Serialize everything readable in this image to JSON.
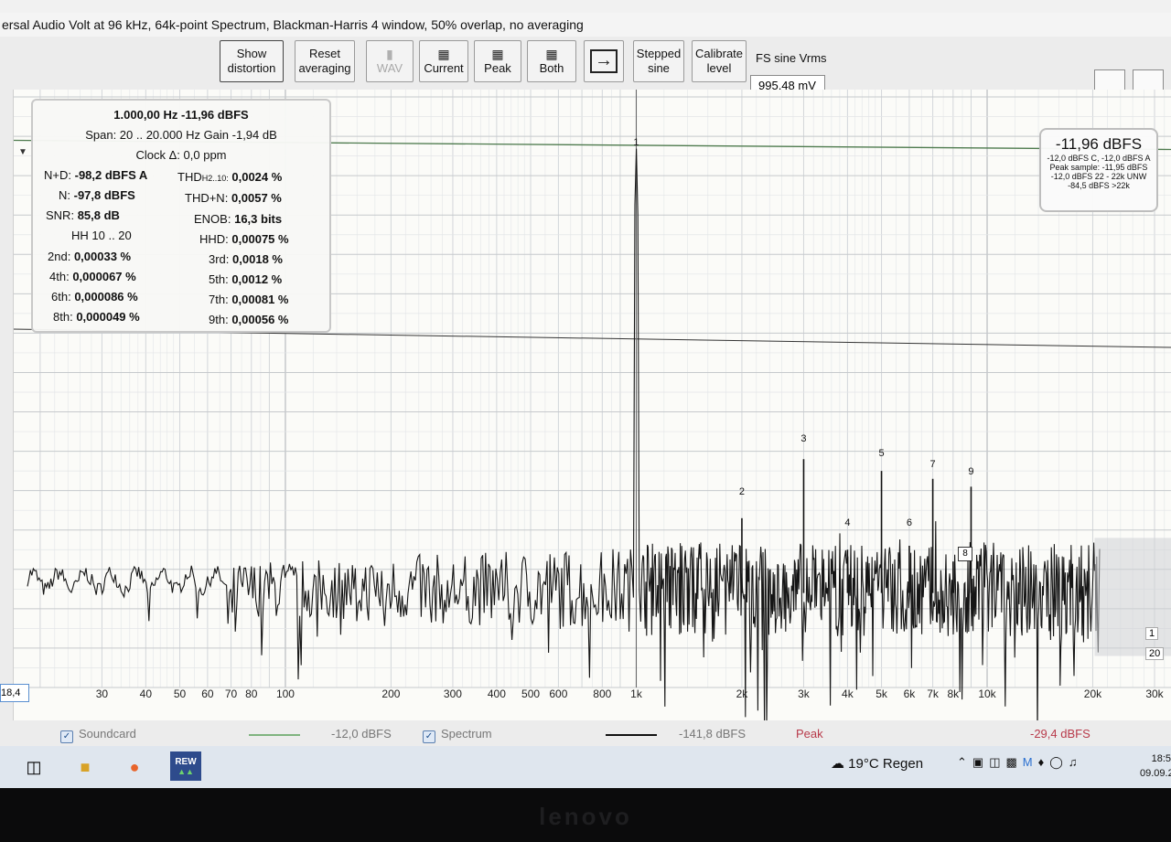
{
  "window": {
    "title": "ersal Audio Volt at 96 kHz, 64k-point Spectrum, Blackman-Harris 4 window, 50% overlap, no averaging"
  },
  "toolbar": {
    "buttons": [
      {
        "label": "Show\ndistortion",
        "icon": ""
      },
      {
        "label": "Reset\naveraging",
        "icon": ""
      },
      {
        "label": "WAV",
        "icon": "folder-icon"
      },
      {
        "label": "Current",
        "icon": "save-icon"
      },
      {
        "label": "Peak",
        "icon": "save-icon"
      },
      {
        "label": "Both",
        "icon": "save-icon"
      },
      {
        "label": "",
        "icon": "import-icon"
      },
      {
        "label": "Stepped\nsine",
        "icon": ""
      },
      {
        "label": "Calibrate\nlevel",
        "icon": ""
      }
    ],
    "fs_label": "FS sine Vrms",
    "fs_value": "995,48 mV"
  },
  "info": {
    "freq": "1.000,00 Hz  -11,96 dBFS",
    "span": "Span: 20 .. 20.000 Hz   Gain -1,94 dB",
    "clock": "Clock Δ: 0,0 ppm",
    "nd_label": "N+D:",
    "nd_value": "-98,2 dBFS A",
    "n_label": "N:",
    "n_value": "-97,8 dBFS",
    "snr_label": "SNR:",
    "snr_value": "85,8 dB",
    "hh": "HH 10 .. 20",
    "thd_label": "THD",
    "thd_sub": "H2..10:",
    "thd_value": "0,0024 %",
    "thdn_label": "THD+N:",
    "thdn_value": "0,0057 %",
    "enob_label": "ENOB:",
    "enob_value": "16,3 bits",
    "hhd_label": "HHD:",
    "hhd_value": "0,00075 %",
    "h2_label": "2nd:",
    "h2_value": "0,00033 %",
    "h3_label": "3rd:",
    "h3_value": "0,0018 %",
    "h4_label": "4th:",
    "h4_value": "0,000067 %",
    "h5_label": "5th:",
    "h5_value": "0,0012 %",
    "h6_label": "6th:",
    "h6_value": "0,000086 %",
    "h7_label": "7th:",
    "h7_value": "0,00081 %",
    "h8_label": "8th:",
    "h8_value": "0,000049 %",
    "h9_label": "9th:",
    "h9_value": "0,00056 %"
  },
  "readout": {
    "main": "-11,96 dBFS",
    "l1": "-12,0 dBFS C, -12,0 dBFS A",
    "l2": "Peak sample: -11,95 dBFS",
    "l3": "-12,0 dBFS 22 - 22k UNW",
    "l4": "-84,5 dBFS >22k"
  },
  "chart_data": {
    "type": "line",
    "x_scale": "log",
    "xlim": [
      18.4,
      30000
    ],
    "x_ticks": [
      "18,4",
      "30",
      "40",
      "50",
      "60",
      "70",
      "80",
      "100",
      "200",
      "300",
      "400",
      "500",
      "600",
      "800",
      "1k",
      "2k",
      "3k",
      "4k",
      "5k",
      "6k",
      "7k",
      "8k",
      "10k",
      "20k",
      "30k"
    ],
    "grid": true,
    "harmonic_labels": [
      "1",
      "2",
      "3",
      "4",
      "5",
      "6",
      "7",
      "8",
      "9"
    ],
    "right_axis_labels": [
      "1",
      "20"
    ],
    "series": [
      {
        "name": "Soundcard",
        "value": "-12,0 dBFS",
        "color": "#7fb37f"
      },
      {
        "name": "Spectrum",
        "value": "-141,8 dBFS",
        "color": "#111111"
      }
    ],
    "fundamental_hz": 1000,
    "fundamental_dbfs": -11.96
  },
  "legend": {
    "soundcard_label": "Soundcard",
    "soundcard_value": "-12,0 dBFS",
    "spectrum_label": "Spectrum",
    "spectrum_value": "-141,8 dBFS",
    "peak_label": "Peak",
    "peak_value": "-29,4 dBFS",
    "peak_color": "#b83a4a"
  },
  "taskbar": {
    "apps": [
      {
        "icon": "task-view-icon"
      },
      {
        "icon": "file-explorer-icon"
      },
      {
        "icon": "firefox-icon"
      },
      {
        "icon": "rew-app-icon",
        "label": "REW"
      }
    ],
    "weather": "19°C  Regen",
    "time": "18:5",
    "date": "09.09.2"
  },
  "bezel": {
    "brand": "lenovo"
  }
}
